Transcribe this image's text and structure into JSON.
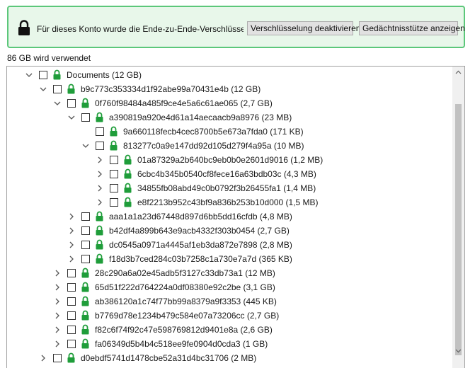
{
  "banner": {
    "message": "Für dieses Konto wurde die Ende-zu-Ende-Verschlüsselung aktiviert",
    "disable_button": "Verschlüsselung deaktivieren",
    "mnemonic_button": "Gedächtnisstütze anzeigen",
    "accent_color": "#5cc77a"
  },
  "usage_text": "86 GB wird verwendet",
  "tree": [
    {
      "level": 0,
      "expanded": true,
      "label": "Documents (12 GB)"
    },
    {
      "level": 1,
      "expanded": true,
      "label": "b9c773c353334d1f92abe99a70431e4b (12 GB)"
    },
    {
      "level": 2,
      "expanded": true,
      "label": "0f760f98484a485f9ce4e5a6c61ae065 (2,7 GB)"
    },
    {
      "level": 3,
      "expanded": true,
      "label": "a390819a920e4d61a14aecaacb9a8976 (23 MB)"
    },
    {
      "level": 4,
      "expanded": null,
      "label": "9a660118fecb4cec8700b5e673a7fda0 (171 KB)"
    },
    {
      "level": 4,
      "expanded": true,
      "label": "813277c0a9e147dd92d105d279f4a95a (10 MB)"
    },
    {
      "level": 5,
      "expanded": false,
      "label": "01a87329a2b640bc9eb0b0e2601d9016 (1,2 MB)"
    },
    {
      "level": 5,
      "expanded": false,
      "label": "6cbc4b345b0540cf8fece16a63bdb03c (4,3 MB)"
    },
    {
      "level": 5,
      "expanded": false,
      "label": "34855fb08abd49c0b0792f3b26455fa1 (1,4 MB)"
    },
    {
      "level": 5,
      "expanded": false,
      "label": "e8f2213b952c43bf9a836b253b10d000 (1,5 MB)"
    },
    {
      "level": 3,
      "expanded": false,
      "label": "aaa1a1a23d67448d897d6bb5dd16cfdb (4,8 MB)"
    },
    {
      "level": 3,
      "expanded": false,
      "label": "b42df4a899b643e9acb4332f303b0454 (2,7 GB)"
    },
    {
      "level": 3,
      "expanded": false,
      "label": "dc0545a0971a4445af1eb3da872e7898 (2,8 MB)"
    },
    {
      "level": 3,
      "expanded": false,
      "label": "f18d3b7ced284c03b7258c1a730e7a7d (365 KB)"
    },
    {
      "level": 2,
      "expanded": false,
      "label": "28c290a6a02e45adb5f3127c33db73a1 (12 MB)"
    },
    {
      "level": 2,
      "expanded": false,
      "label": "65d51f222d764224a0df08380e92c2be (3,1 GB)"
    },
    {
      "level": 2,
      "expanded": false,
      "label": "ab386120a1c74f77bb99a8379a9f3353 (445 KB)"
    },
    {
      "level": 2,
      "expanded": false,
      "label": "b7769d78e1234b479c584e07a73206cc (2,7 GB)"
    },
    {
      "level": 2,
      "expanded": false,
      "label": "f82c6f74f92c47e598769812d9401e8a (2,6 GB)"
    },
    {
      "level": 2,
      "expanded": false,
      "label": "fa06349d5b4b4c518ee9fe0904d0cda3 (1 GB)"
    },
    {
      "level": 1,
      "expanded": false,
      "label": "d0ebdf5741d1478cbe52a31d4bc31706 (2 MB)"
    }
  ],
  "icons": {
    "lock": "lock-icon",
    "check": "green-lock"
  },
  "colors": {
    "lock_green": "#1f9d3a"
  }
}
